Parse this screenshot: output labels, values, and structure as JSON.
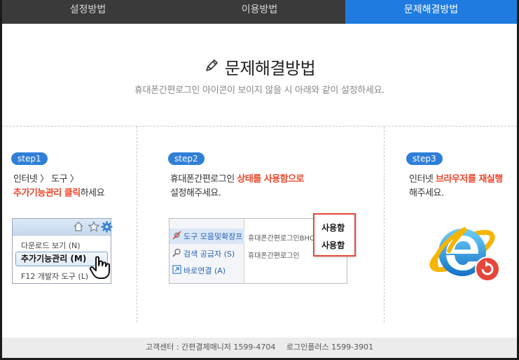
{
  "tabs": [
    {
      "label": "설정방법"
    },
    {
      "label": "이용방법"
    },
    {
      "label": "문제해결방법"
    }
  ],
  "header": {
    "title": "문제해결방법",
    "subtitle": "휴대폰간편로그인 아이콘이 보이지 않을 시 아래와 같이 설정하세요."
  },
  "step1": {
    "badge": "step1",
    "line1": "인터넷 〉 도구 〉",
    "line2_red": "추가기능관리 클릭",
    "line2_rest": "하세요",
    "menu": {
      "item1": "다운로드 보기 (N)",
      "selected": "추가기능관리 (M)",
      "item3": "F12  개발자 도구 (L)"
    }
  },
  "step2": {
    "badge": "step2",
    "line1_pre": "휴대폰간편로그인 ",
    "line1_red": "상태를 사용함으로",
    "line2": "설정해주세요.",
    "menu": {
      "left1": "도구 모음및확장프",
      "left2": "검색 공급자 (S)",
      "left3": "바로연결 (A)",
      "right1": "휴대폰간편로그인BHO",
      "right2": "휴대폰간편로그인"
    },
    "popup": [
      "사용함",
      "사용함"
    ]
  },
  "step3": {
    "badge": "step3",
    "line1_pre": "인터넷 ",
    "line1_red": "브라우저를 재실행",
    "line2": "해주세요."
  },
  "footer": {
    "center": "고객센터 : 간편결제매니저 1599-4704",
    "plus": "로그인플러스 1599-3901"
  },
  "colors": {
    "tab_active": "#1f7be0",
    "badge": "#2f7fd8",
    "highlight_red": "#e8462a"
  }
}
